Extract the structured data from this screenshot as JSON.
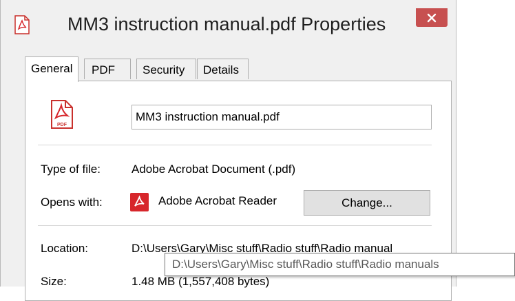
{
  "window": {
    "title": "MM3 instruction manual.pdf Properties",
    "close_glyph": "×",
    "close_color": "#c75050",
    "title_icon": "pdf-file-icon"
  },
  "tabs": [
    {
      "label": "General",
      "active": true
    },
    {
      "label": "PDF",
      "active": false
    },
    {
      "label": "Security",
      "active": false
    },
    {
      "label": "Details",
      "active": false
    }
  ],
  "general": {
    "file_icon": "pdf-document-icon",
    "file_icon_badge": "PDF",
    "filename": "MM3 instruction manual.pdf",
    "type_label": "Type of file:",
    "type_value": "Adobe Acrobat Document (.pdf)",
    "opens_label": "Opens with:",
    "opens_app_icon": "acrobat-reader-icon",
    "opens_value": "Adobe Acrobat Reader",
    "change_button": "Change...",
    "location_label": "Location:",
    "location_value": "D:\\Users\\Gary\\Misc stuff\\Radio stuff\\Radio manual",
    "size_label": "Size:",
    "size_value": "1.48 MB (1,557,408 bytes)"
  },
  "tooltip": {
    "text": "D:\\Users\\Gary\\Misc stuff\\Radio stuff\\Radio manuals"
  },
  "colors": {
    "acrobat_red": "#d7262b",
    "panel_bg": "#ffffff",
    "window_bg": "#f0f0f0"
  }
}
